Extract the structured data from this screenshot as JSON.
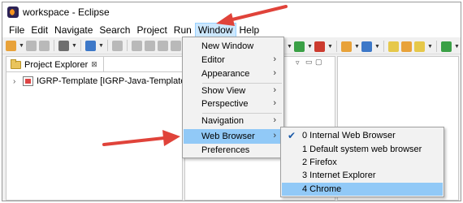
{
  "window": {
    "title": "workspace - Eclipse"
  },
  "menubar": {
    "items": [
      "File",
      "Edit",
      "Navigate",
      "Search",
      "Project",
      "Run",
      "Window",
      "Help"
    ],
    "active": "Window"
  },
  "project_explorer": {
    "tab_title": "Project Explorer",
    "close_glyph": "⊠",
    "tree": [
      {
        "label": "IGRP-Template [IGRP-Java-Template-Ec"
      }
    ]
  },
  "window_menu": {
    "items": [
      {
        "label": "New Window",
        "has_submenu": false
      },
      {
        "label": "Editor",
        "has_submenu": true
      },
      {
        "label": "Appearance",
        "has_submenu": true
      },
      {
        "label": "Show View",
        "has_submenu": true
      },
      {
        "label": "Perspective",
        "has_submenu": true
      },
      {
        "label": "Navigation",
        "has_submenu": true
      },
      {
        "label": "Web Browser",
        "has_submenu": true,
        "highlighted": true
      },
      {
        "label": "Preferences",
        "has_submenu": false
      }
    ],
    "submenu_arrow": "›"
  },
  "web_browser_submenu": {
    "items": [
      {
        "label": "0 Internal Web Browser",
        "checked": true
      },
      {
        "label": "1 Default system web browser"
      },
      {
        "label": "2 Firefox"
      },
      {
        "label": "3 Internet Explorer"
      },
      {
        "label": "4 Chrome",
        "highlighted": true
      }
    ],
    "check_glyph": "✔"
  },
  "colors": {
    "highlight": "#91c9f7",
    "menu_bg": "#f2f2f2",
    "annotation_arrow": "#e0433a"
  }
}
